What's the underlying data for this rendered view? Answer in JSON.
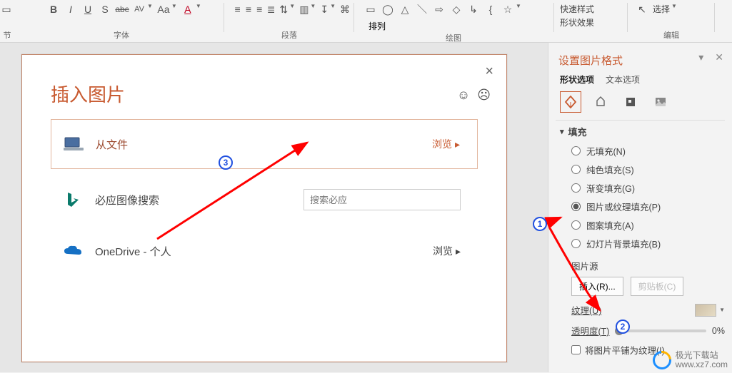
{
  "ribbon": {
    "font_label": "字体",
    "para_label": "段落",
    "draw_label": "绘图",
    "edit_label": "编辑",
    "outline_btn": "节",
    "arrange_label": "排列",
    "quickstyle_label": "快速样式",
    "shapefill_label": "形状效果",
    "select_label": "选择",
    "bold": "B",
    "italic": "I",
    "underline": "U",
    "shadow": "S",
    "strike": "abc",
    "spacing": "AV",
    "changecase": "Aa",
    "fontcolor": "A"
  },
  "dialog": {
    "title": "插入图片",
    "close": "×",
    "from_file": {
      "label": "从文件",
      "action": "浏览",
      "arrow": "▸"
    },
    "bing": {
      "label": "必应图像搜索",
      "placeholder": "搜索必应"
    },
    "onedrive": {
      "label": "OneDrive - 个人",
      "action": "浏览",
      "arrow": "▸"
    }
  },
  "pane": {
    "title": "设置图片格式",
    "tabs": {
      "shape": "形状选项",
      "text": "文本选项"
    },
    "section_fill": "填充",
    "fill_options": {
      "none": "无填充(N)",
      "solid": "纯色填充(S)",
      "gradient": "渐变填充(G)",
      "picture": "图片或纹理填充(P)",
      "pattern": "图案填充(A)",
      "slidebg": "幻灯片背景填充(B)"
    },
    "picture_src": "图片源",
    "insert_btn": "插入(R)...",
    "clipboard_btn": "剪贴板(C)",
    "texture_label": "纹理(U)",
    "transparency_label": "透明度(T)",
    "transparency_value": "0%",
    "tile_label": "将图片平铺为纹理(I)"
  },
  "annotations": {
    "b1": "1",
    "b2": "2",
    "b3": "3"
  },
  "watermark": {
    "name": "极光下载站",
    "url": "www.xz7.com"
  }
}
